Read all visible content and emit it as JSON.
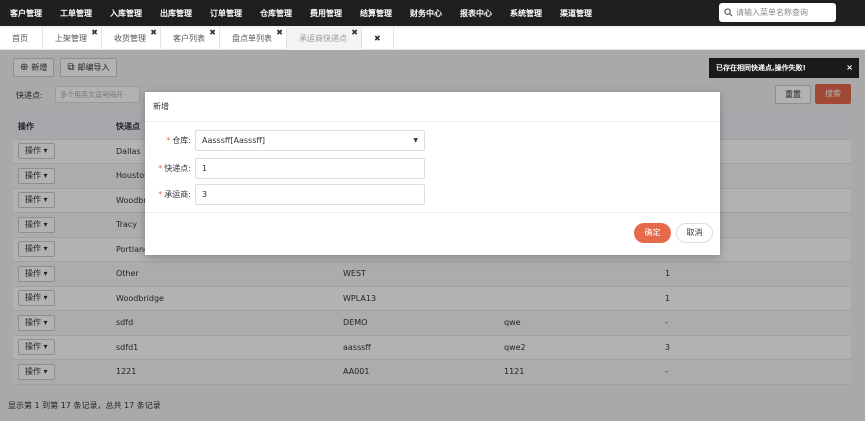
{
  "nav": {
    "items": [
      "客户管理",
      "工单管理",
      "入库管理",
      "出库管理",
      "订单管理",
      "仓库管理",
      "费用管理",
      "结算管理",
      "财务中心",
      "报表中心",
      "系统管理",
      "渠道管理"
    ],
    "search_placeholder": "请输入菜单名称查询"
  },
  "tabs": [
    {
      "label": "首页",
      "closable": false,
      "active": false
    },
    {
      "label": "上架管理",
      "closable": true,
      "active": false
    },
    {
      "label": "收货管理",
      "closable": true,
      "active": false
    },
    {
      "label": "客户列表",
      "closable": true,
      "active": false
    },
    {
      "label": "盘点单列表",
      "closable": true,
      "active": false
    },
    {
      "label": "承运商快递点",
      "closable": true,
      "active": true
    }
  ],
  "tab_close_all": "✖",
  "toolbar": {
    "add_label": "新增",
    "import_label": "邮编导入"
  },
  "filter": {
    "label": "快递点:",
    "placeholder": "多个用英文逗号隔开",
    "reset_label": "重置",
    "search_label": "搜索"
  },
  "table": {
    "headers": [
      "操作",
      "快递点",
      "",
      "",
      ""
    ],
    "op_label": "操作 ▾",
    "rows": [
      [
        "Dallas",
        "",
        "",
        ""
      ],
      [
        "Houston",
        "",
        "",
        ""
      ],
      [
        "Woodbri",
        "",
        "",
        ""
      ],
      [
        "Tracy",
        "",
        "",
        ""
      ],
      [
        "Portland",
        "",
        "",
        ""
      ],
      [
        "Other",
        "WEST",
        "",
        "1"
      ],
      [
        "Woodbridge",
        "WPLA13",
        "",
        "1"
      ],
      [
        "sdfd",
        "DEMO",
        "qwe",
        "-"
      ],
      [
        "sdfd1",
        "aasssff",
        "qwe2",
        "3"
      ],
      [
        "1221",
        "AA001",
        "1121",
        "-"
      ]
    ]
  },
  "footer": "显示第 1 到第 17 条记录，总共 17 条记录",
  "toast": {
    "message": "已存在相同快递点,操作失败!",
    "close": "×"
  },
  "modal": {
    "title": "新增",
    "warehouse_label": "仓库:",
    "warehouse_value": "Aasssff[Aasssff]",
    "express_label": "快递点:",
    "express_value": "1",
    "carrier_label": "承运商:",
    "carrier_value": "3",
    "ok_label": "确定",
    "cancel_label": "取消"
  }
}
